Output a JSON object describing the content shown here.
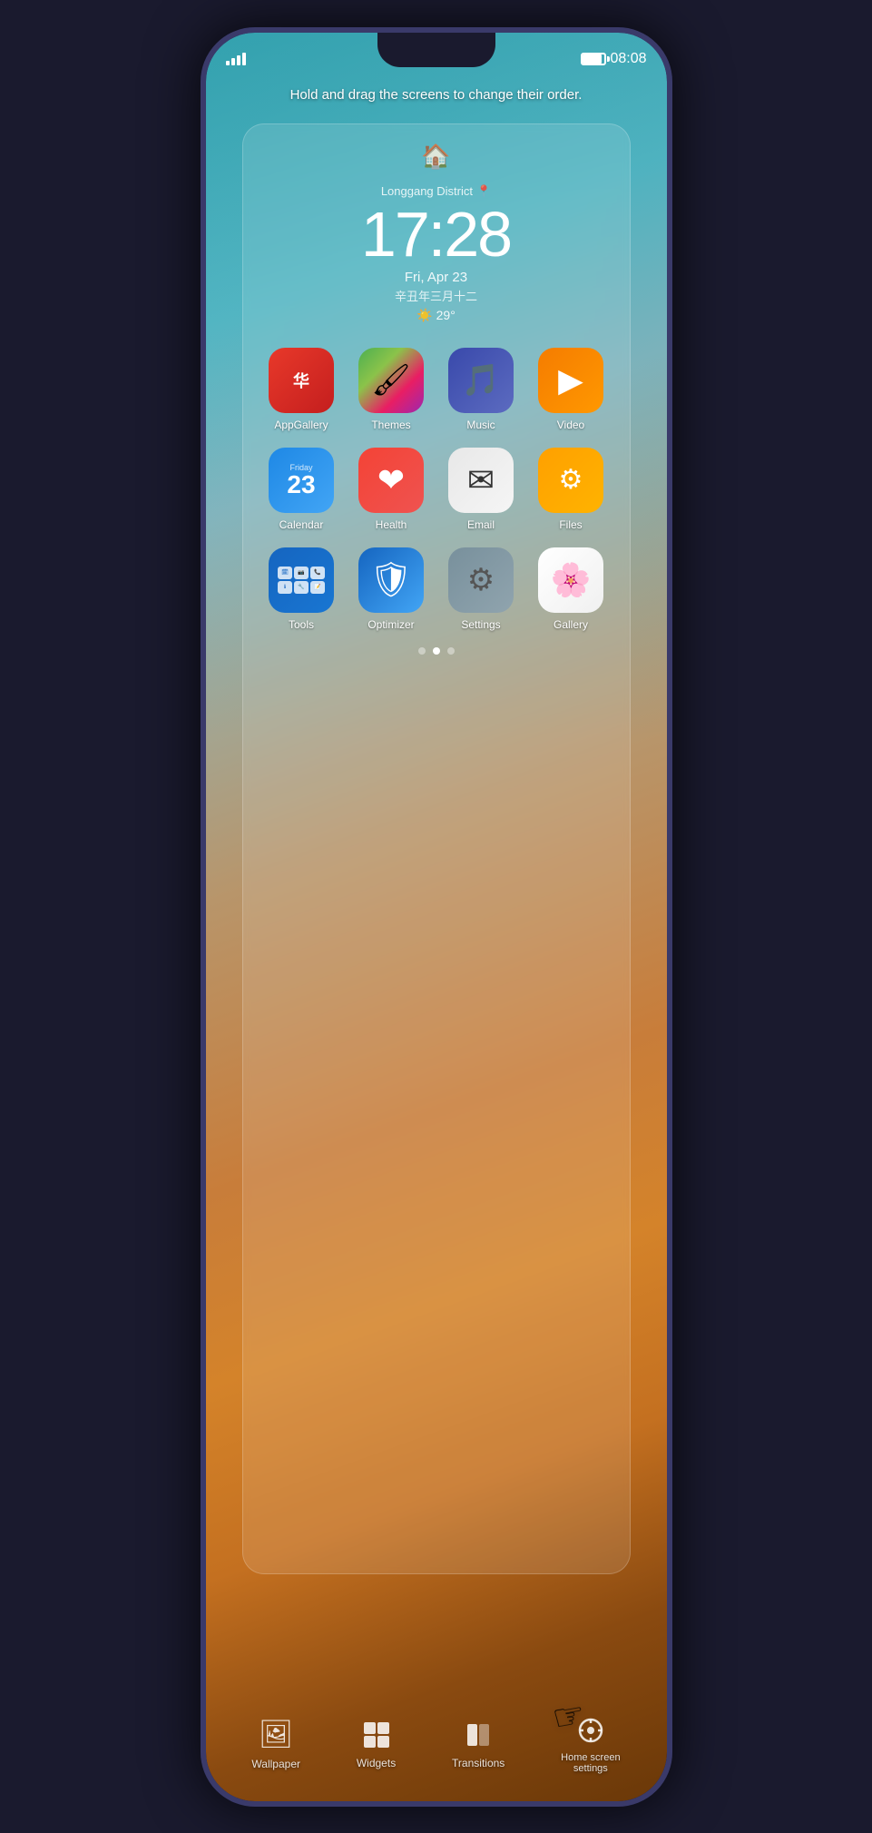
{
  "status_bar": {
    "time": "08:08",
    "signal_level": 4,
    "battery_percent": 85
  },
  "instruction": {
    "text": "Hold and drag the screens to change their order."
  },
  "clock": {
    "location": "Longgang District",
    "time": "17:28",
    "date": "Fri, Apr 23",
    "chinese_date": "辛丑年三月十二",
    "weather": "29°",
    "weather_icon": "☀️"
  },
  "apps": [
    {
      "id": "appgallery",
      "label": "AppGallery",
      "icon_type": "appgallery"
    },
    {
      "id": "themes",
      "label": "Themes",
      "icon_type": "themes"
    },
    {
      "id": "music",
      "label": "Music",
      "icon_type": "music"
    },
    {
      "id": "video",
      "label": "Video",
      "icon_type": "video"
    },
    {
      "id": "calendar",
      "label": "Calendar",
      "icon_type": "calendar",
      "day": "23",
      "day_label": "Friday"
    },
    {
      "id": "health",
      "label": "Health",
      "icon_type": "health"
    },
    {
      "id": "email",
      "label": "Email",
      "icon_type": "email"
    },
    {
      "id": "files",
      "label": "Files",
      "icon_type": "files"
    },
    {
      "id": "tools",
      "label": "Tools",
      "icon_type": "tools"
    },
    {
      "id": "optimizer",
      "label": "Optimizer",
      "icon_type": "optimizer"
    },
    {
      "id": "settings",
      "label": "Settings",
      "icon_type": "settings"
    },
    {
      "id": "gallery",
      "label": "Gallery",
      "icon_type": "gallery"
    }
  ],
  "page_dots": [
    {
      "active": false
    },
    {
      "active": true
    },
    {
      "active": false
    }
  ],
  "toolbar": {
    "items": [
      {
        "id": "wallpaper",
        "label": "Wallpaper",
        "icon": "🖼"
      },
      {
        "id": "widgets",
        "label": "Widgets",
        "icon": "⊞"
      },
      {
        "id": "transitions",
        "label": "Transitions",
        "icon": "▱"
      },
      {
        "id": "home-settings",
        "label": "Home screen\nsettings",
        "icon": "⚙"
      }
    ]
  },
  "location_pin": "📍"
}
